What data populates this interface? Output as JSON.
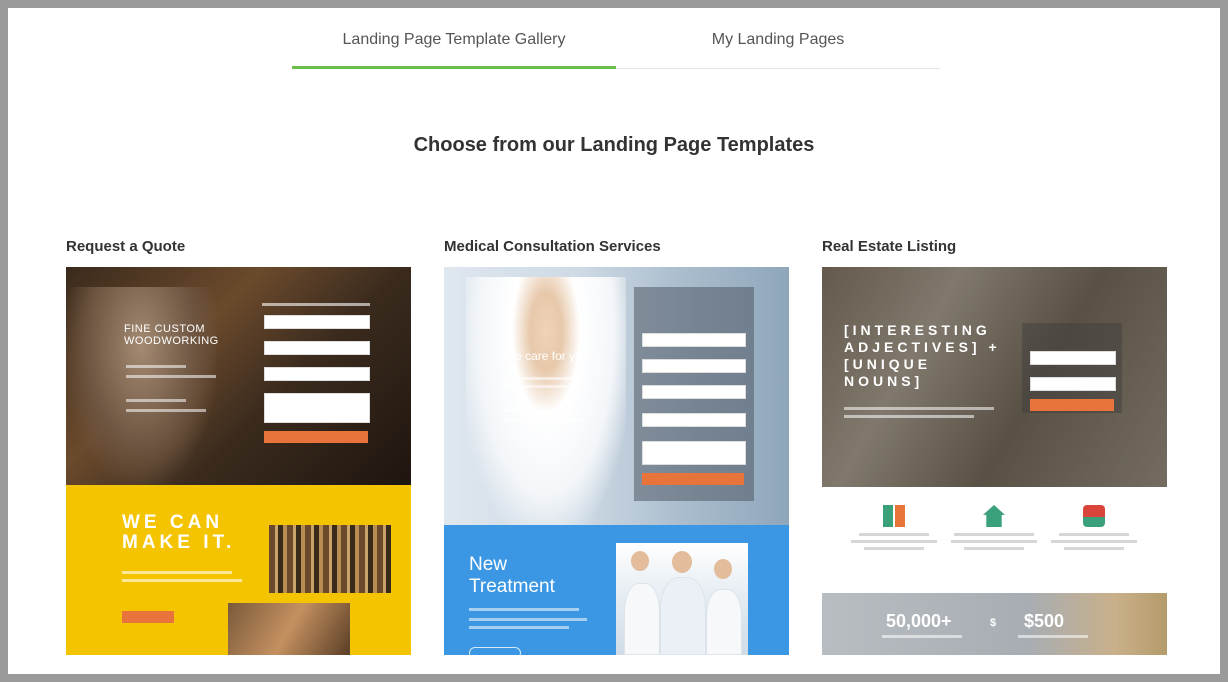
{
  "tabs": [
    {
      "label": "Landing Page Template Gallery",
      "active": true
    },
    {
      "label": "My Landing Pages",
      "active": false
    }
  ],
  "heading": "Choose from our Landing Page Templates",
  "accent_color": "#6cc04a",
  "templates": [
    {
      "title": "Request a Quote",
      "preview": {
        "hero_heading": "FINE CUSTOM WOODWORKING",
        "tagline": "WE CAN MAKE IT."
      }
    },
    {
      "title": "Medical Consultation Services",
      "preview": {
        "hero_heading": "We care for you",
        "tagline": "New Treatment"
      }
    },
    {
      "title": "Real Estate Listing",
      "preview": {
        "hero_heading": "[INTERESTING ADJECTIVES] + [UNIQUE NOUNS]",
        "stat_1": "50,000+",
        "stat_sep": "$",
        "stat_2": "$500"
      }
    }
  ]
}
